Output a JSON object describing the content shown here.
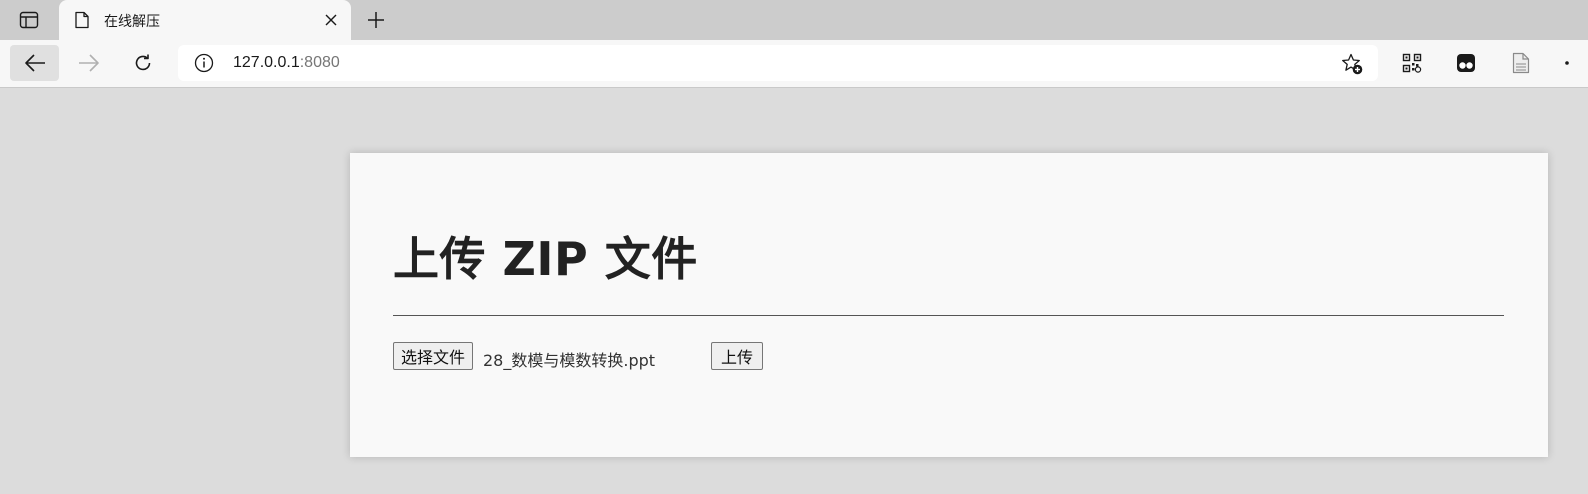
{
  "browser": {
    "tab": {
      "title": "在线解压"
    },
    "address": {
      "host": "127.0.0.1",
      "port": ":8080"
    },
    "icons": {
      "tab_actions": "tab-actions-icon",
      "favicon": "page-icon",
      "close": "close-icon",
      "new_tab": "plus-icon",
      "back": "back-arrow-icon",
      "forward": "forward-arrow-icon",
      "reload": "reload-icon",
      "info": "info-icon",
      "favorite": "star-add-icon",
      "qr": "qr-code-icon",
      "extension": "tampermonkey-icon",
      "reading": "document-icon"
    }
  },
  "page": {
    "title": "上传 ZIP 文件",
    "form": {
      "choose_file_label": "选择文件",
      "selected_file": "28_数模与模数转换.ppt",
      "upload_label": "上传"
    }
  }
}
